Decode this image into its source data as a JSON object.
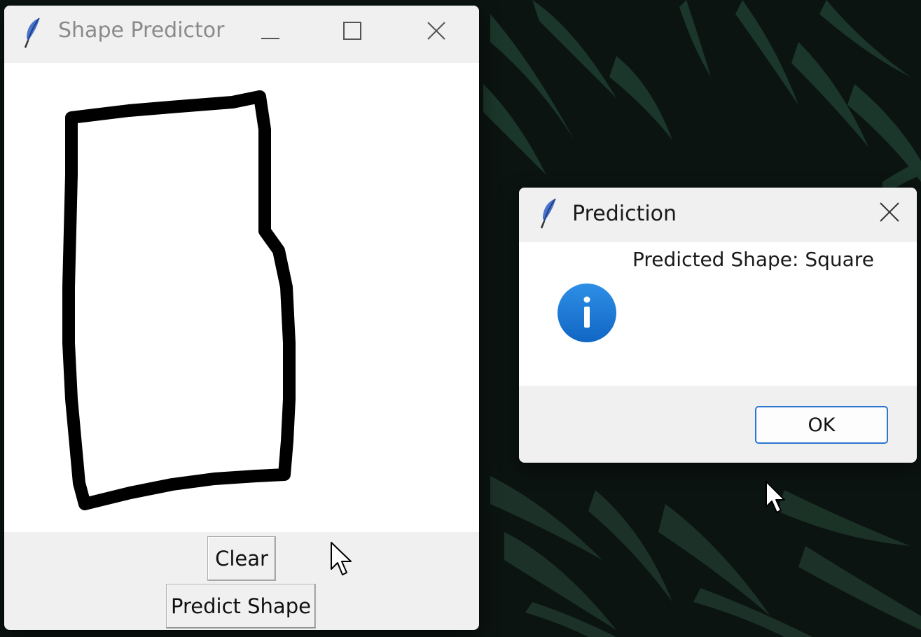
{
  "main_window": {
    "title": "Shape Predictor",
    "icon": "feather-icon",
    "controls": [
      "minimize-icon",
      "maximize-icon",
      "close-icon"
    ],
    "buttons": {
      "clear": "Clear",
      "predict": "Predict Shape"
    }
  },
  "dialog": {
    "title": "Prediction",
    "icon": "feather-icon",
    "info_icon": "info-icon",
    "message": "Predicted Shape: Square",
    "ok_label": "OK"
  },
  "colors": {
    "dialog_ok_border": "#2a76d2",
    "info_icon": "#1a78d6",
    "window_chrome": "#f0f0f0",
    "canvas": "#ffffff",
    "stroke": "#000000"
  }
}
